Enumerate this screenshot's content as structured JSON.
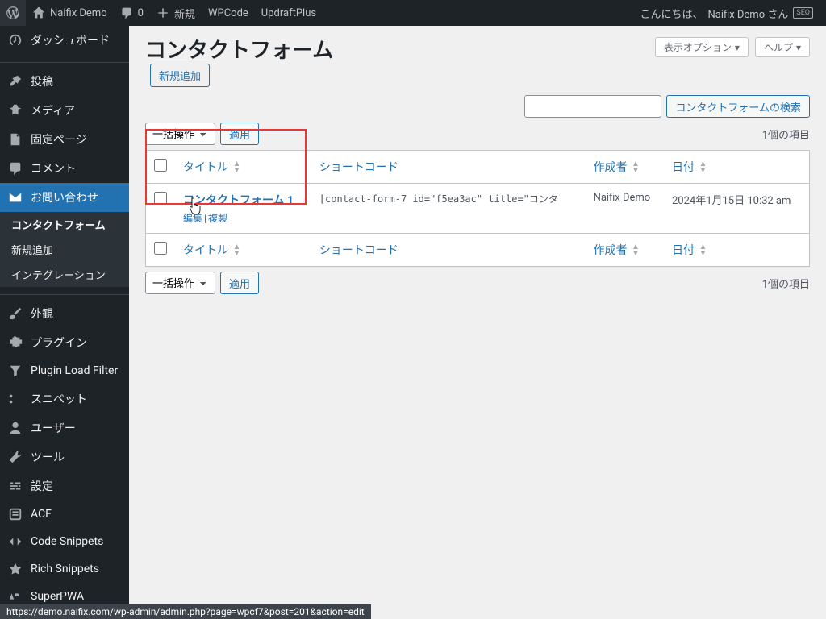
{
  "adminbar": {
    "site_name": "Naifix Demo",
    "comments": "0",
    "new": "新規",
    "wpcode": "WPCode",
    "updraft": "UpdraftPlus",
    "howdy_prefix": "こんにちは、",
    "user_display": "Naifix Demo さん",
    "seo_badge": "SEO"
  },
  "menu": {
    "dashboard": "ダッシュボード",
    "posts": "投稿",
    "media": "メディア",
    "pages": "固定ページ",
    "comments": "コメント",
    "contact": "お問い合わせ",
    "appearance": "外観",
    "plugins": "プラグイン",
    "plf": "Plugin Load Filter",
    "snippets": "スニペット",
    "users": "ユーザー",
    "tools": "ツール",
    "settings": "設定",
    "acf": "ACF",
    "code_snippets": "Code Snippets",
    "rich_snippets": "Rich Snippets",
    "superpwa": "SuperPWA"
  },
  "submenu": {
    "contact_forms": "コンタクトフォーム",
    "add_new": "新規追加",
    "integration": "インテグレーション"
  },
  "page": {
    "title": "コンタクトフォーム",
    "add_new": "新規追加",
    "screen_options": "表示オプション",
    "help": "ヘルプ",
    "search_button": "コンタクトフォームの検索",
    "bulk_action": "一括操作",
    "apply": "適用",
    "items_count": "1個の項目"
  },
  "table": {
    "col_title": "タイトル",
    "col_shortcode": "ショートコード",
    "col_author": "作成者",
    "col_date": "日付",
    "row": {
      "title": "コンタクトフォーム 1",
      "shortcode": "[contact-form-7 id=\"f5ea3ac\" title=\"コンタ",
      "author": "Naifix Demo",
      "date": "2024年1月15日 10:32 am",
      "edit": "編集",
      "duplicate": "複製"
    }
  },
  "status_url": "https://demo.naifix.com/wp-admin/admin.php?page=wpcf7&post=201&action=edit"
}
